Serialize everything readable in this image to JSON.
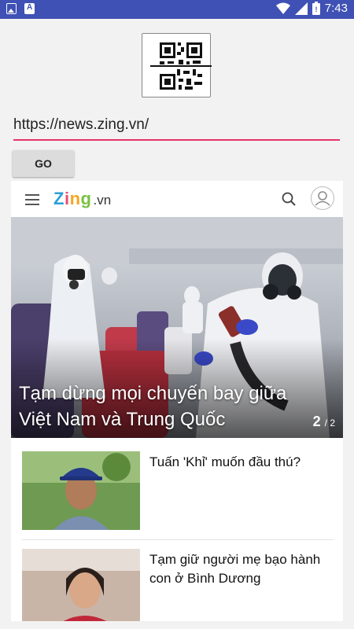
{
  "status_bar": {
    "time": "7:43",
    "left_icons": [
      "image-notification-icon",
      "a-notification-icon"
    ],
    "right_icons": [
      "wifi-icon",
      "signal-icon",
      "battery-icon"
    ]
  },
  "toolbar": {
    "qr_icon": "qr-code-icon",
    "url_value": "https://news.zing.vn/",
    "go_label": "GO"
  },
  "webview": {
    "site": {
      "logo_main": "Zing",
      "logo_suffix": ".vn"
    },
    "header_icons": [
      "menu-icon",
      "search-icon",
      "user-icon"
    ],
    "hero": {
      "title": "Tạm dừng mọi chuyến bay giữa Việt Nam và Trung Quốc",
      "counter_current": "2",
      "counter_total": "/ 2"
    },
    "articles": [
      {
        "title": "Tuấn 'Khỉ' muốn đầu thú?"
      },
      {
        "title": "Tạm giữ người mẹ bạo hành con ở Bình Dương"
      }
    ]
  },
  "colors": {
    "status_bar": "#3f51b5",
    "url_underline": "#e5336b",
    "page_bg": "#f2f2f2"
  }
}
